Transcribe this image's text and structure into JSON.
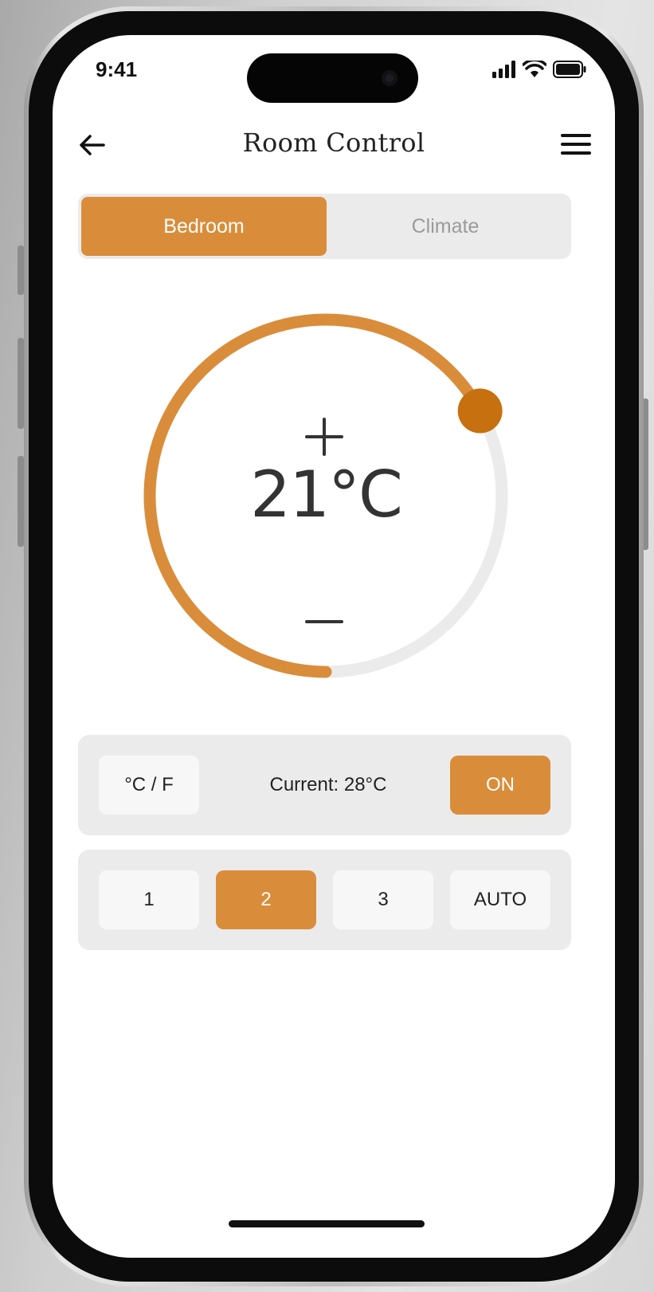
{
  "status_bar": {
    "time": "9:41"
  },
  "nav": {
    "title": "Room Control"
  },
  "tabs": [
    {
      "label": "Bedroom",
      "active": true
    },
    {
      "label": "Climate",
      "active": false
    }
  ],
  "thermostat": {
    "temperature": "21°C",
    "plus_symbol": "+",
    "minus_symbol": "—",
    "level_fraction": 0.67
  },
  "controls": {
    "unit_toggle": "°C / F",
    "current_label": "Current: 28°C",
    "power_label": "ON"
  },
  "fan_speeds": [
    {
      "label": "1",
      "active": false
    },
    {
      "label": "2",
      "active": true
    },
    {
      "label": "3",
      "active": false
    },
    {
      "label": "AUTO",
      "active": false
    }
  ],
  "colors": {
    "accent": "#d98d3a",
    "knob": "#c7700f",
    "track": "#ebebeb",
    "text": "#333333"
  },
  "icons": [
    "arrow-left-icon",
    "menu-icon",
    "signal-icon",
    "wifi-icon",
    "battery-icon"
  ]
}
